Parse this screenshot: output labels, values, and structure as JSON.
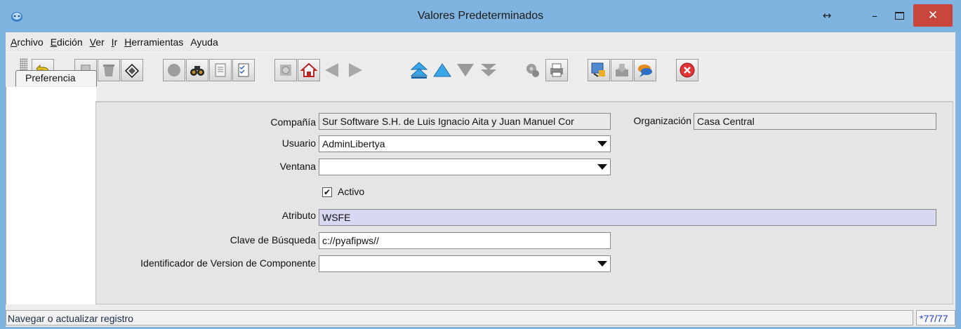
{
  "window": {
    "title": "Valores Predeterminados"
  },
  "menu": [
    {
      "label": "Archivo"
    },
    {
      "label": "Edición"
    },
    {
      "label": "Ver"
    },
    {
      "label": "Ir"
    },
    {
      "label": "Herramientas"
    },
    {
      "label": "Ayuda"
    }
  ],
  "tabs": [
    {
      "label": "Preferencia"
    }
  ],
  "form": {
    "company_label": "Compañía",
    "company_value": "Sur Software S.H. de Luis Ignacio Aita y Juan Manuel Cor",
    "org_label": "Organización",
    "org_value": "Casa Central",
    "user_label": "Usuario",
    "user_value": "AdminLibertya",
    "window_label": "Ventana",
    "window_value": "",
    "active_label": "Activo",
    "active_checked": "✔",
    "attribute_label": "Atributo",
    "attribute_value": "WSFE",
    "search_key_label": "Clave de Búsqueda",
    "search_key_value": "c://pyafipws//",
    "component_label": "Identificador de Version de Componente",
    "component_value": ""
  },
  "status": {
    "message": "Navegar o actualizar registro",
    "record_count": "*77/77"
  },
  "colors": {
    "accent": "#7fb3e0",
    "close": "#c9463d",
    "required_field": "#d8d8f2"
  }
}
